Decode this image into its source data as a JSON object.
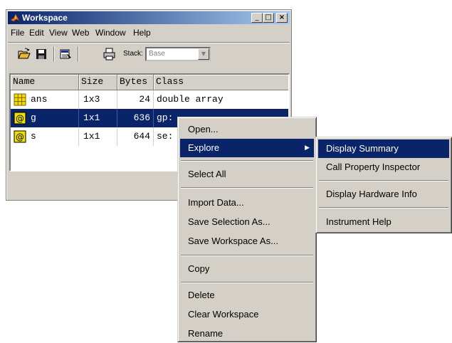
{
  "window": {
    "title": "Workspace",
    "buttons": {
      "minimize": "_",
      "maximize": "□",
      "close": "×"
    }
  },
  "menubar": [
    "File",
    "Edit",
    "View",
    "Web",
    "Window",
    "Help"
  ],
  "toolbar": {
    "icons": [
      "open-icon",
      "save-icon",
      "import-data-icon",
      "print-icon"
    ],
    "stack_label": "Stack:",
    "stack_value": "Base"
  },
  "table": {
    "columns": [
      "Name",
      "Size",
      "Bytes",
      "Class"
    ],
    "rows": [
      {
        "name": "ans",
        "size": "1x3",
        "bytes": "24",
        "class": "double array",
        "icon": "matrix-icon"
      },
      {
        "name": "g",
        "size": "1x1",
        "bytes": "636",
        "class": "gp:",
        "icon": "object-icon"
      },
      {
        "name": "s",
        "size": "1x1",
        "bytes": "644",
        "class": "se:",
        "icon": "object-icon"
      }
    ]
  },
  "context_menu": {
    "items": [
      "Open...",
      "Explore",
      "Select All",
      "Import Data...",
      "Save Selection As...",
      "Save Workspace As...",
      "Copy",
      "Delete",
      "Clear Workspace",
      "Rename"
    ],
    "highlighted": "Explore"
  },
  "submenu": {
    "items": [
      "Display Summary",
      "Call Property Inspector",
      "Display Hardware Info",
      "Instrument Help"
    ],
    "highlighted": "Display Summary"
  },
  "colors": {
    "selection": "#0a246a",
    "face": "#d4d0c8",
    "title_gradient_end": "#a6caf0"
  }
}
